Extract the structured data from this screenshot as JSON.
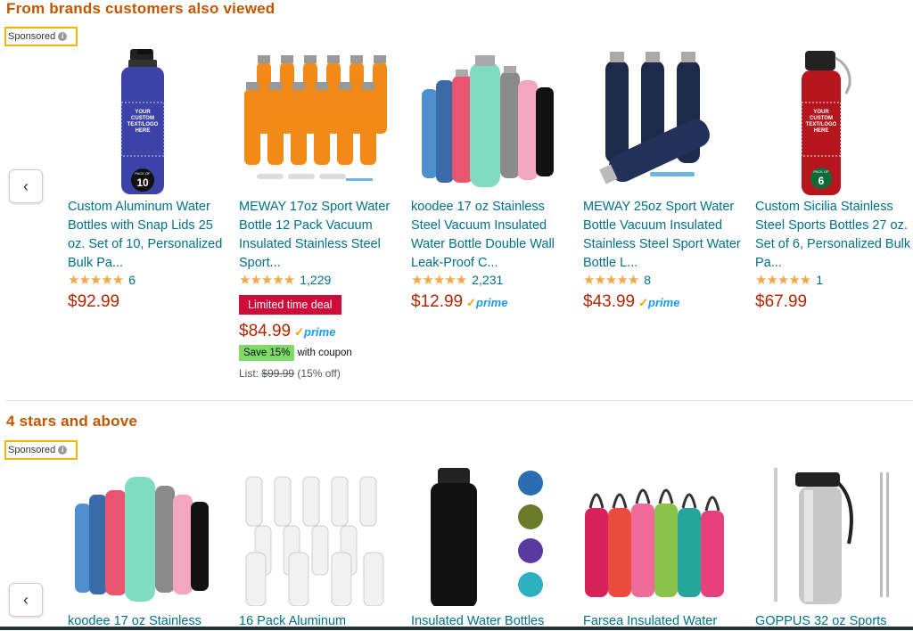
{
  "section1": {
    "title": "From brands customers also viewed",
    "sponsored": "Sponsored",
    "products": [
      {
        "title": "Custom Aluminum Water Bottles with Snap Lids 25 oz. Set of 10, Personalized Bulk Pa...",
        "stars": "★★★★★",
        "rating_count": "6",
        "price": "$92.99",
        "prime": false,
        "image_text": "YOUR CUSTOM TEXT/LOGO HERE",
        "badge": "PACK OF",
        "badge_num": "10"
      },
      {
        "title": "MEWAY 17oz Sport Water Bottle 12 Pack Vacuum Insulated Stainless Steel Sport...",
        "stars": "★★★★★",
        "rating_count": "1,229",
        "deal": "Limited time deal",
        "price": "$84.99",
        "prime": true,
        "coupon_badge": "Save 15%",
        "coupon_text": "with coupon",
        "list_label": "List:",
        "list_price": "$99.99",
        "list_off": "(15% off)"
      },
      {
        "title": "koodee 17 oz Stainless Steel Vacuum Insulated Water Bottle Double Wall Leak-Proof C...",
        "stars": "★★★★★",
        "rating_count": "2,231",
        "price": "$12.99",
        "prime": true
      },
      {
        "title": "MEWAY 25oz Sport Water Bottle Vacuum Insulated Stainless Steel Sport Water Bottle L...",
        "stars": "★★★★★",
        "rating_count": "8",
        "price": "$43.99",
        "prime": true
      },
      {
        "title": "Custom Sicilia Stainless Steel Sports Bottles 27 oz. Set of 6, Personalized Bulk Pa...",
        "stars": "★★★★★",
        "rating_count": "1",
        "price": "$67.99",
        "prime": false,
        "image_text": "YOUR CUSTOM TEXT/LOGO HERE",
        "badge": "PACK OF",
        "badge_num": "6"
      }
    ]
  },
  "section2": {
    "title": "4 stars and above",
    "sponsored": "Sponsored",
    "products": [
      {
        "title": "koodee 17 oz Stainless"
      },
      {
        "title": "16 Pack Aluminum"
      },
      {
        "title": "Insulated Water Bottles"
      },
      {
        "title": "Farsea Insulated Water"
      },
      {
        "title": "GOPPUS 32 oz Sports"
      }
    ]
  },
  "prime_label": "prime",
  "prime_check": "✓",
  "arrow": "‹",
  "info": "i",
  "colors": {
    "link": "#007185",
    "price": "#b12704",
    "heading": "#c45500",
    "star": "#f3a847",
    "deal": "#cc0c39",
    "sponsored_border": "#f4b400"
  }
}
